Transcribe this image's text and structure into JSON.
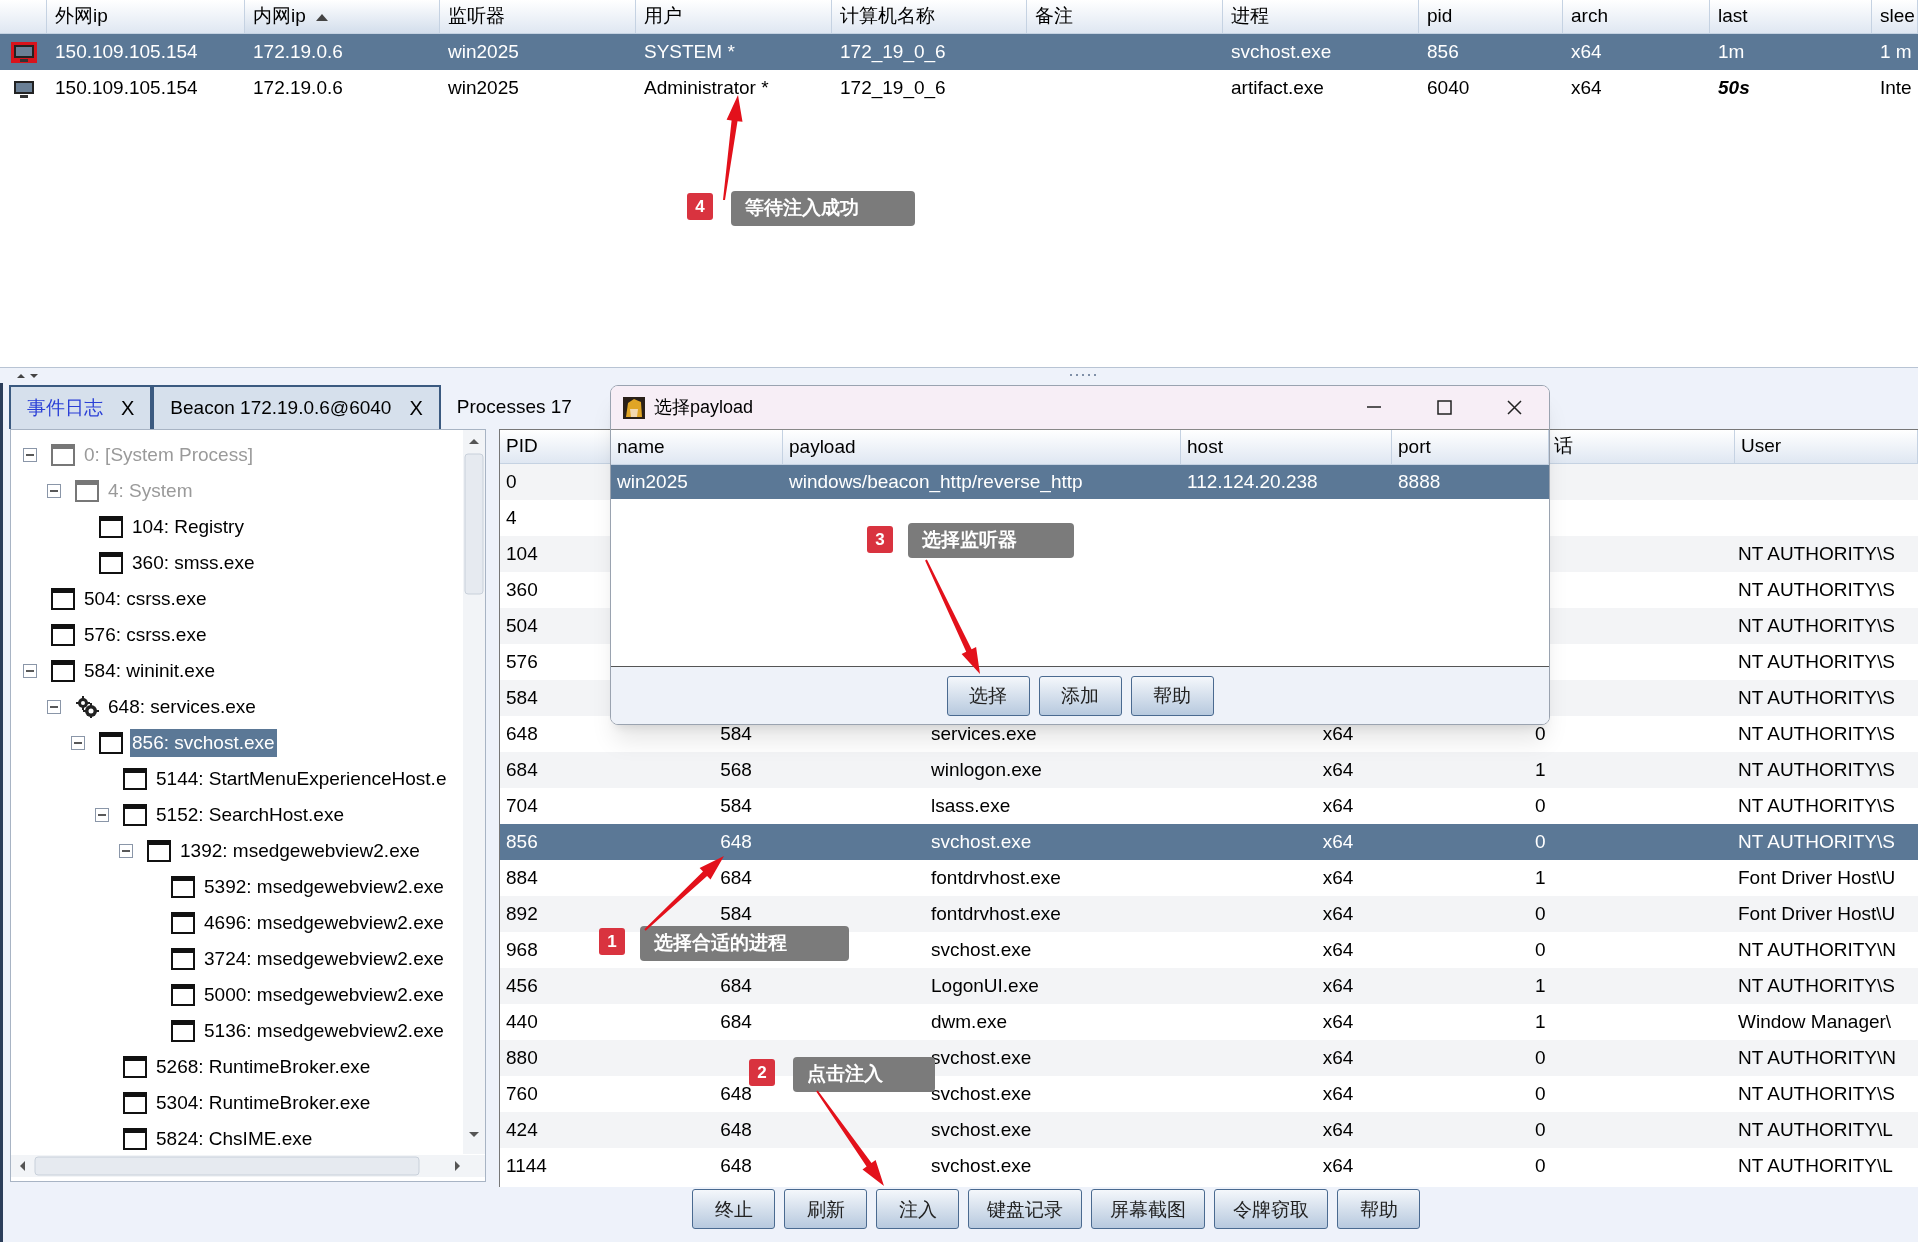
{
  "sessions": {
    "columns": [
      {
        "label": "外网ip",
        "sorted": false
      },
      {
        "label": "内网ip",
        "sorted": true
      },
      {
        "label": "监听器",
        "sorted": false
      },
      {
        "label": "用户",
        "sorted": false
      },
      {
        "label": "计算机名称",
        "sorted": false
      },
      {
        "label": "备注",
        "sorted": false
      },
      {
        "label": "进程",
        "sorted": false
      },
      {
        "label": "pid",
        "sorted": false
      },
      {
        "label": "arch",
        "sorted": false
      },
      {
        "label": "last",
        "sorted": false
      },
      {
        "label": "slee",
        "sorted": false
      }
    ],
    "rows": [
      {
        "external_ip": "150.109.105.154",
        "internal_ip": "172.19.0.6",
        "listener": "win2025",
        "user": "SYSTEM *",
        "computer": "172_19_0_6",
        "process": "svchost.exe",
        "pid": "856",
        "arch": "x64",
        "last": "1m",
        "sleep": "1 m",
        "elevated": true,
        "last_emphasis": false,
        "selected": true
      },
      {
        "external_ip": "150.109.105.154",
        "internal_ip": "172.19.0.6",
        "listener": "win2025",
        "user": "Administrator *",
        "computer": "172_19_0_6",
        "process": "artifact.exe",
        "pid": "6040",
        "arch": "x64",
        "last": "50s",
        "sleep": "Inte",
        "elevated": false,
        "last_emphasis": true,
        "selected": false
      }
    ]
  },
  "tabs": [
    {
      "label": "事件日志",
      "kind": "log",
      "close": "X",
      "selected": false
    },
    {
      "label": "Beacon 172.19.0.6@6040",
      "kind": "beacon",
      "close": "X",
      "selected": false
    },
    {
      "label": "Processes 17",
      "kind": "processes",
      "selected": true
    }
  ],
  "process_tree": [
    {
      "label": "0: [System Process]",
      "kind": "window",
      "dimmed": true,
      "selected": false,
      "expanded": true,
      "children": [
        {
          "label": "4: System",
          "kind": "window",
          "dimmed": true,
          "selected": false,
          "expanded": true,
          "children": [
            {
              "label": "104: Registry",
              "kind": "window",
              "dimmed": false,
              "selected": false
            },
            {
              "label": "360: smss.exe",
              "kind": "window",
              "dimmed": false,
              "selected": false
            }
          ]
        }
      ]
    },
    {
      "label": "504: csrss.exe",
      "kind": "window",
      "dimmed": false,
      "selected": false
    },
    {
      "label": "576: csrss.exe",
      "kind": "window",
      "dimmed": false,
      "selected": false
    },
    {
      "label": "584: wininit.exe",
      "kind": "window",
      "dimmed": false,
      "selected": false,
      "expanded": true,
      "children": [
        {
          "label": "648: services.exe",
          "kind": "gear",
          "dimmed": false,
          "selected": false,
          "expanded": true,
          "children": [
            {
              "label": "856: svchost.exe",
              "kind": "window",
              "dimmed": false,
              "selected": true,
              "expanded": true,
              "children": [
                {
                  "label": "5144: StartMenuExperienceHost.e",
                  "kind": "window",
                  "dimmed": false,
                  "selected": false
                },
                {
                  "label": "5152: SearchHost.exe",
                  "kind": "window",
                  "dimmed": false,
                  "selected": false,
                  "expanded": true,
                  "children": [
                    {
                      "label": "1392: msedgewebview2.exe",
                      "kind": "window",
                      "dimmed": false,
                      "selected": false,
                      "expanded": true,
                      "children": [
                        {
                          "label": "5392: msedgewebview2.exe",
                          "kind": "window",
                          "dimmed": false,
                          "selected": false
                        },
                        {
                          "label": "4696: msedgewebview2.exe",
                          "kind": "window",
                          "dimmed": false,
                          "selected": false
                        },
                        {
                          "label": "3724: msedgewebview2.exe",
                          "kind": "window",
                          "dimmed": false,
                          "selected": false
                        },
                        {
                          "label": "5000: msedgewebview2.exe",
                          "kind": "window",
                          "dimmed": false,
                          "selected": false
                        },
                        {
                          "label": "5136: msedgewebview2.exe",
                          "kind": "window",
                          "dimmed": false,
                          "selected": false
                        }
                      ]
                    }
                  ]
                },
                {
                  "label": "5268: RuntimeBroker.exe",
                  "kind": "window",
                  "dimmed": false,
                  "selected": false
                },
                {
                  "label": "5304: RuntimeBroker.exe",
                  "kind": "window",
                  "dimmed": false,
                  "selected": false
                },
                {
                  "label": "5824: ChsIME.exe",
                  "kind": "window",
                  "dimmed": false,
                  "selected": false
                }
              ]
            }
          ]
        }
      ]
    }
  ],
  "processes": {
    "columns": [
      "PID",
      "话",
      "User"
    ],
    "rows": [
      {
        "pid": "0",
        "selected": false
      },
      {
        "pid": "4",
        "selected": false
      },
      {
        "pid": "104",
        "user": "NT AUTHORITY\\S",
        "selected": false
      },
      {
        "pid": "360",
        "user": "NT AUTHORITY\\S",
        "selected": false
      },
      {
        "pid": "504",
        "user": "NT AUTHORITY\\S",
        "selected": false
      },
      {
        "pid": "576",
        "user": "NT AUTHORITY\\S",
        "selected": false
      },
      {
        "pid": "584",
        "user": "NT AUTHORITY\\S",
        "selected": false
      },
      {
        "pid": "648",
        "ppid": "584",
        "name": "services.exe",
        "arch": "x64",
        "session": "0",
        "user": "NT AUTHORITY\\S",
        "selected": false
      },
      {
        "pid": "684",
        "ppid": "568",
        "name": "winlogon.exe",
        "arch": "x64",
        "session": "1",
        "user": "NT AUTHORITY\\S",
        "selected": false
      },
      {
        "pid": "704",
        "ppid": "584",
        "name": "lsass.exe",
        "arch": "x64",
        "session": "0",
        "user": "NT AUTHORITY\\S",
        "selected": false
      },
      {
        "pid": "856",
        "ppid": "648",
        "name": "svchost.exe",
        "arch": "x64",
        "session": "0",
        "user": "NT AUTHORITY\\S",
        "selected": true
      },
      {
        "pid": "884",
        "ppid": "684",
        "name": "fontdrvhost.exe",
        "arch": "x64",
        "session": "1",
        "user": "Font Driver Host\\U",
        "selected": false
      },
      {
        "pid": "892",
        "ppid": "584",
        "name": "fontdrvhost.exe",
        "arch": "x64",
        "session": "0",
        "user": "Font Driver Host\\U",
        "selected": false
      },
      {
        "pid": "968",
        "name": "svchost.exe",
        "arch": "x64",
        "session": "0",
        "user": "NT AUTHORITY\\N",
        "selected": false
      },
      {
        "pid": "456",
        "ppid": "684",
        "name": "LogonUI.exe",
        "arch": "x64",
        "session": "1",
        "user": "NT AUTHORITY\\S",
        "selected": false
      },
      {
        "pid": "440",
        "ppid": "684",
        "name": "dwm.exe",
        "arch": "x64",
        "session": "1",
        "user": "Window Manager\\",
        "selected": false
      },
      {
        "pid": "880",
        "name": "svchost.exe",
        "arch": "x64",
        "session": "0",
        "user": "NT AUTHORITY\\N",
        "selected": false
      },
      {
        "pid": "760",
        "ppid": "648",
        "name": "svchost.exe",
        "arch": "x64",
        "session": "0",
        "user": "NT AUTHORITY\\S",
        "selected": false
      },
      {
        "pid": "424",
        "ppid": "648",
        "name": "svchost.exe",
        "arch": "x64",
        "session": "0",
        "user": "NT AUTHORITY\\L",
        "selected": false
      },
      {
        "pid": "1144",
        "ppid": "648",
        "name": "svchost.exe",
        "arch": "x64",
        "session": "0",
        "user": "NT AUTHORITY\\L",
        "selected": false
      }
    ]
  },
  "dialog": {
    "title": "选择payload",
    "columns": [
      "name",
      "payload",
      "host",
      "port"
    ],
    "rows": [
      {
        "name": "win2025",
        "payload": "windows/beacon_http/reverse_http",
        "host": "112.124.20.238",
        "port": "8888",
        "selected": true
      }
    ],
    "buttons": [
      "选择",
      "添加",
      "帮助"
    ]
  },
  "buttons": [
    "终止",
    "刷新",
    "注入",
    "键盘记录",
    "屏幕截图",
    "令牌窃取",
    "帮助"
  ],
  "annotations": [
    {
      "number": "4",
      "text": "等待注入成功"
    },
    {
      "number": "3",
      "text": "选择监听器"
    },
    {
      "number": "1",
      "text": "选择合适的进程"
    },
    {
      "number": "2",
      "text": "点击注入"
    }
  ]
}
